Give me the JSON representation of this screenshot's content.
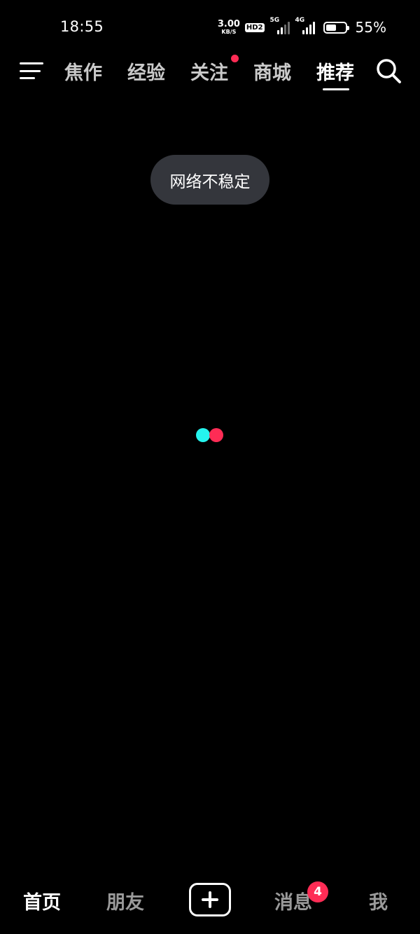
{
  "status_bar": {
    "time": "18:55",
    "net_speed": "3.00",
    "net_speed_unit": "KB/S",
    "hd_label": "HD2",
    "signal_1_gen": "5G",
    "signal_2_gen": "4G",
    "battery_percent_text": "55%",
    "battery_level": 0.55
  },
  "top_nav": {
    "menu_icon": "hamburger-menu-icon",
    "tabs": [
      {
        "label": "焦作",
        "active": false
      },
      {
        "label": "经验",
        "active": false
      },
      {
        "label": "关注",
        "active": false,
        "has_dot": true
      },
      {
        "label": "商城",
        "active": false
      },
      {
        "label": "推荐",
        "active": true
      }
    ],
    "search_icon": "search-icon"
  },
  "toast": {
    "text": "网络不稳定"
  },
  "loader": {
    "colors": [
      "#25f4ee",
      "#fe2c55"
    ]
  },
  "bottom_nav": {
    "items": [
      {
        "label": "首页",
        "active": true
      },
      {
        "label": "朋友",
        "active": false
      },
      {
        "label": "消息",
        "active": false,
        "badge": "4"
      },
      {
        "label": "我",
        "active": false
      }
    ],
    "create_icon": "plus-icon"
  },
  "colors": {
    "background": "#000000",
    "accent_red": "#fe2c55",
    "accent_cyan": "#25f4ee",
    "toast_bg": "#34363c",
    "inactive_text": "#9a9a9a"
  }
}
